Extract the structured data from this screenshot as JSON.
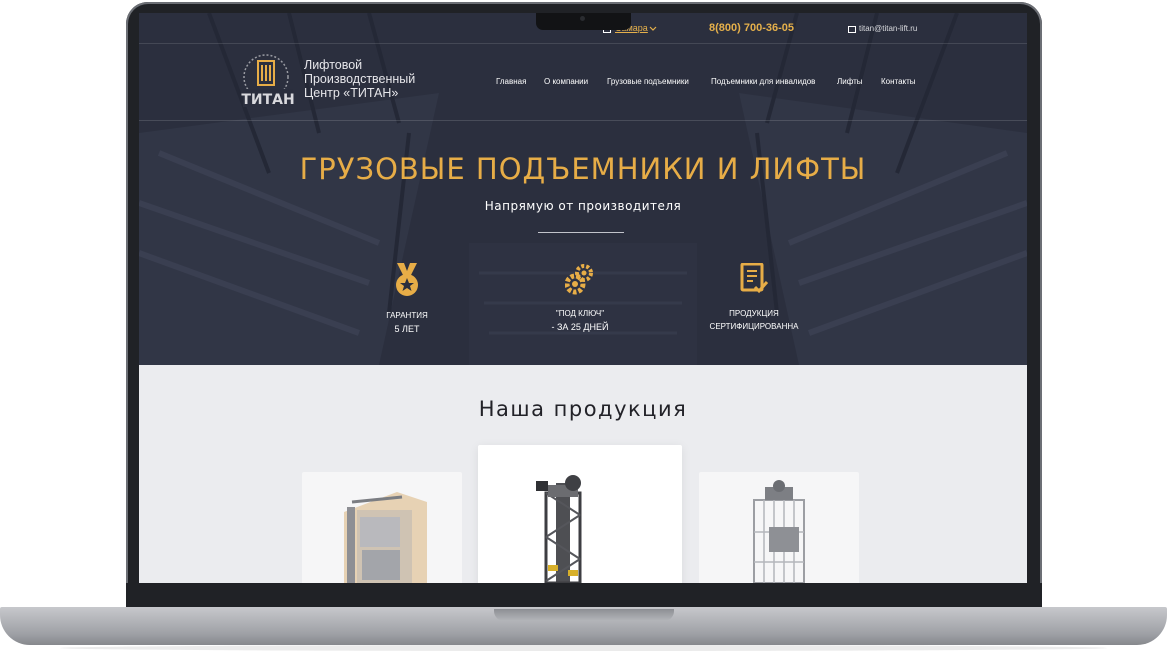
{
  "topbar": {
    "city": "Самара",
    "phone": "8(800) 700-36-05",
    "email": "titan@titan-lift.ru"
  },
  "brand": {
    "logo_text": "ТИТАН",
    "line1": "Лифтовой",
    "line2": "Производственный",
    "line3": "Центр «ТИТАН»"
  },
  "nav": [
    "Главная",
    "О компании",
    "Грузовые подъемники",
    "Подъемники для инвалидов",
    "Лифты",
    "Контакты"
  ],
  "hero": {
    "title": "ГРУЗОВЫЕ ПОДЪЕМНИКИ И ЛИФТЫ",
    "subtitle": "Напрямую от производителя"
  },
  "features": [
    {
      "icon": "medal-icon",
      "line1": "ГАРАНТИЯ",
      "line2": "5 ЛЕТ"
    },
    {
      "icon": "gears-icon",
      "line1": "\"ПОД КЛЮЧ\"",
      "line2": "- ЗА 25 ДНЕЙ"
    },
    {
      "icon": "certificate-icon",
      "line1": "ПРОДУКЦИЯ",
      "line2": "СЕРТИФИЦИРОВАННА"
    }
  ],
  "products": {
    "title": "Наша продукция"
  },
  "colors": {
    "accent": "#e7ad47",
    "hero_bg": "#2a2e3d",
    "section_bg": "#ebecef"
  }
}
